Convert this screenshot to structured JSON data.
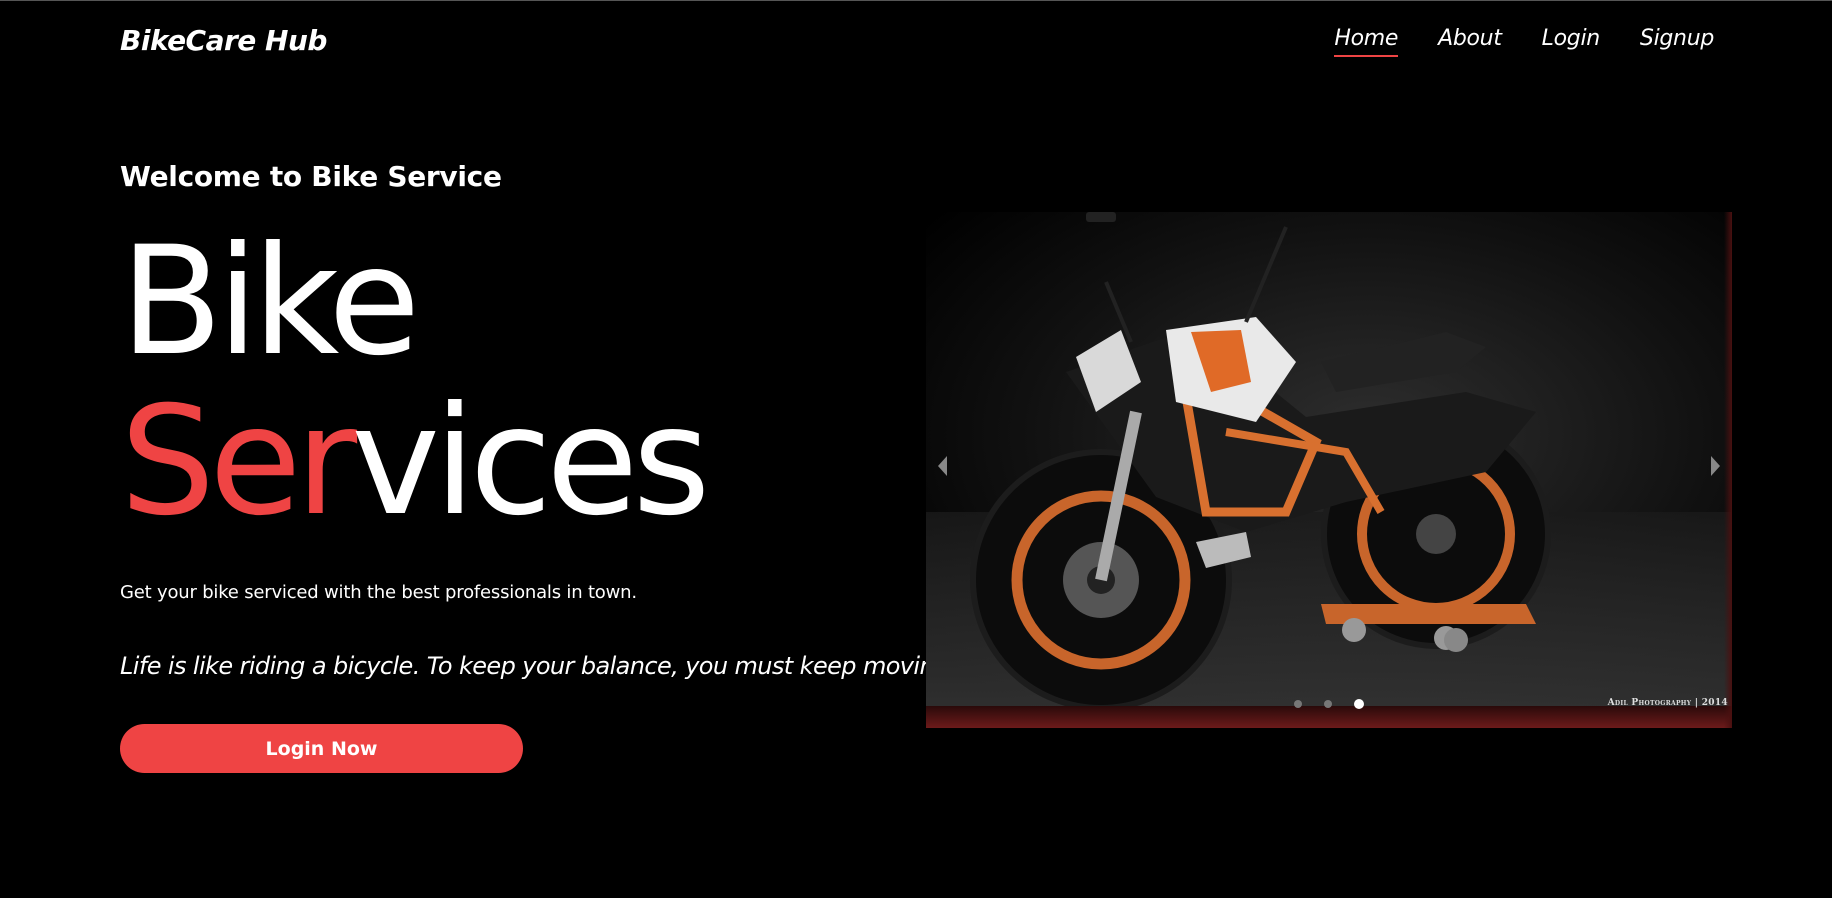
{
  "navbar": {
    "brand": "BikeCare Hub",
    "links": [
      {
        "label": "Home",
        "active": true
      },
      {
        "label": "About",
        "active": false
      },
      {
        "label": "Login",
        "active": false
      },
      {
        "label": "Signup",
        "active": false
      }
    ]
  },
  "hero": {
    "welcome": "Welcome to Bike Service",
    "title_line1": "Bike",
    "title_line2_accent": "Ser",
    "title_line2_rest": "vices",
    "subtext": "Get your bike serviced with the best professionals in town.",
    "quote": "Life is like riding a bicycle. To keep your balance, you must keep moving.",
    "cta_label": "Login Now"
  },
  "carousel": {
    "slide_count": 3,
    "active_slide": 3,
    "photo_credit": "Adil Photography | 2014",
    "icons": {
      "prev": "chevron-left-icon",
      "next": "chevron-right-icon"
    }
  },
  "colors": {
    "background": "#000000",
    "accent": "#ef4444",
    "text": "#ffffff"
  }
}
